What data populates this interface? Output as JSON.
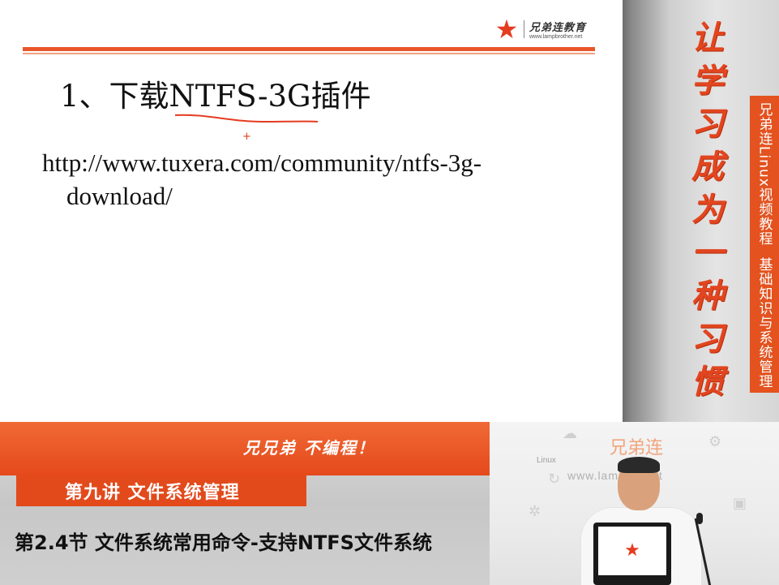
{
  "slide": {
    "logo": {
      "icon": "red-star-logo-icon",
      "name": "兄弟连教育",
      "url": "www.lampbrother.net"
    },
    "title": "1、下载NTFS-3G插件",
    "link_line1": "http://www.tuxera.com/community/ntfs-3g-",
    "link_line2": "download/"
  },
  "banner": {
    "slogan_chars": [
      "让",
      "学",
      "习",
      "成",
      "为",
      "一",
      "种",
      "习",
      "惯"
    ],
    "side_tab_part1": "兄弟连Linux视频教程",
    "side_tab_part2": "基础知识与系统管理"
  },
  "lower_third": {
    "orange_slogan": "兄兄弟 不编程！",
    "lecture": "第九讲 文件系统管理",
    "section": "第2.4节 文件系统常用命令-支持NTFS文件系统"
  },
  "webcam": {
    "brand": "兄弟连",
    "linux_label": "Linux",
    "url_watermark": "www.lamp     er.net"
  },
  "colors": {
    "accent_orange": "#e5491c",
    "banner_red": "#e2451f"
  }
}
